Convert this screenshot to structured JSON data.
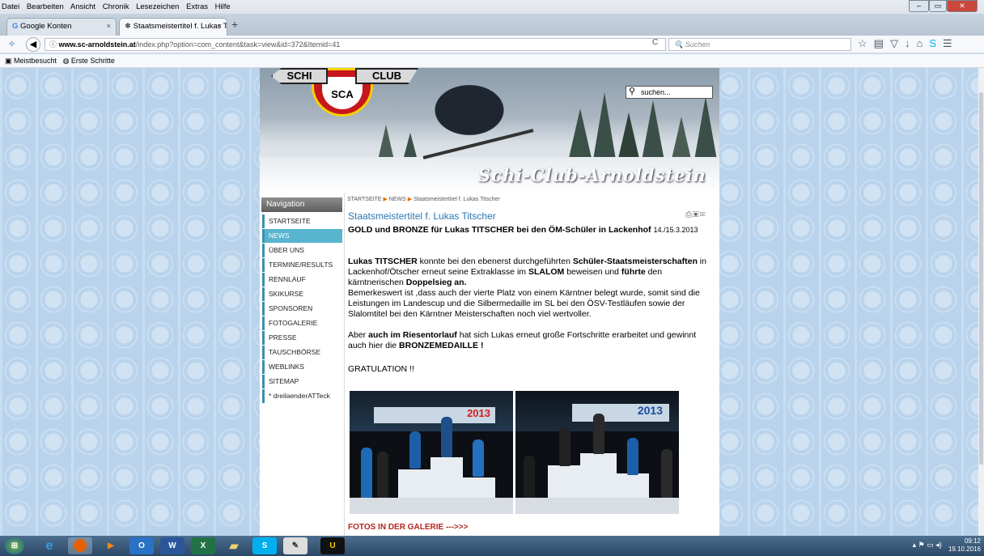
{
  "browser": {
    "menu": [
      "Datei",
      "Bearbeiten",
      "Ansicht",
      "Chronik",
      "Lesezeichen",
      "Extras",
      "Hilfe"
    ],
    "tabs": [
      {
        "label": "Google Konten"
      },
      {
        "label": "Staatsmeistertitel f. Lukas T..."
      }
    ],
    "url_domain": "www.sc-arnoldstein.at",
    "url_path": "/index.php?option=com_content&task=view&id=372&Itemid=41",
    "search_placeholder": "Suchen",
    "bookmarks": [
      "Meistbesucht",
      "Erste Schritte"
    ]
  },
  "site": {
    "logo_left": "SCHI",
    "logo_right": "CLUB",
    "logo_text": "SCA",
    "title": "Schi-Club-Arnoldstein",
    "search_placeholder": "suchen...",
    "nav_title": "Navigation",
    "nav": [
      {
        "label": "STARTSEITE"
      },
      {
        "label": "NEWS",
        "active": true
      },
      {
        "label": "ÜBER UNS"
      },
      {
        "label": "TERMINE/RESULTS"
      },
      {
        "label": "RENNLAUF"
      },
      {
        "label": "SKIKURSE"
      },
      {
        "label": "SPONSOREN"
      },
      {
        "label": "FOTOGALERIE"
      },
      {
        "label": "PRESSE"
      },
      {
        "label": "TAUSCHBÖRSE"
      },
      {
        "label": "WEBLINKS"
      },
      {
        "label": "SITEMAP"
      },
      {
        "label": "* dreilaenderATTeck"
      }
    ],
    "breadcrumb": [
      "STARTSEITE",
      "NEWS",
      "Staatsmeistertitel f. Lukas Titscher"
    ],
    "article": {
      "title": "Staatsmeistertitel f. Lukas Titscher",
      "subtitle": "GOLD und BRONZE für Lukas TITSCHER bei den ÖM-Schüler in Lackenhof",
      "date": "14./15.3.2013",
      "p1_b1": "Lukas TITSCHER",
      "p1_t1": " konnte bei den ebenerst durchgeführten ",
      "p1_b2": "Schüler-Staatsmeisterschaften",
      "p1_t2": " in Lackenhof/Ötscher erneut seine Extraklasse im ",
      "p1_b3": "SLALOM",
      "p1_t3": " beweisen und ",
      "p1_b4": "führte",
      "p1_t4": " den kärntnerischen ",
      "p1_b5": "Doppelsieg an.",
      "p2": "Bemerkeswert ist ,dass auch der vierte Platz von einem Kärntner belegt wurde, somit sind die Leistungen im Landescup und die Silbermedaille im SL bei den ÖSV-Testläufen sowie der Slalomtitel bei den Kärntner Meisterschaften noch viel wertvoller.",
      "p3_t1": "Aber ",
      "p3_b1": "auch im Riesentorlauf",
      "p3_t2": " hat sich Lukas erneut große Fortschritte erarbeitet und gewinnt auch hier die ",
      "p3_b2": "BRONZEMEDAILLE !",
      "p4": "GRATULATION !!",
      "photo_text_1": "2013",
      "photo_text_2": "2013",
      "gallery_link": "FOTOS IN DER GALERIE --->>>"
    }
  },
  "taskbar": {
    "time": "09:12",
    "date": "19.10.2016"
  }
}
